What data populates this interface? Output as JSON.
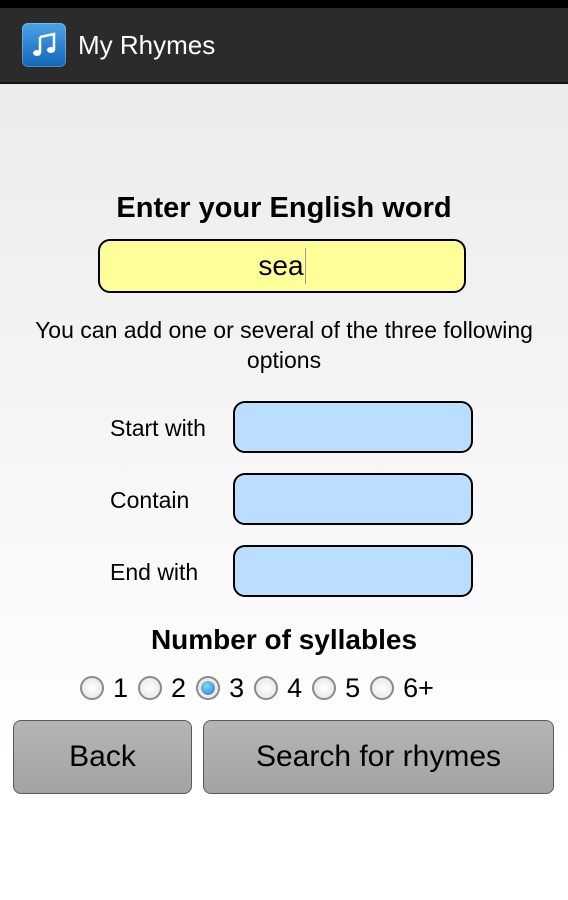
{
  "app": {
    "title": "My Rhymes",
    "icon": "music-note-icon",
    "accent_color": "#1565b8"
  },
  "word": {
    "label": "Enter your English word",
    "value": "sea"
  },
  "hint": "You can add one or several of the three following options",
  "options": [
    {
      "label": "Start with",
      "value": ""
    },
    {
      "label": "Contain",
      "value": ""
    },
    {
      "label": "End with",
      "value": ""
    }
  ],
  "syllables": {
    "label": "Number of syllables",
    "choices": [
      "1",
      "2",
      "3",
      "4",
      "5",
      "6+"
    ],
    "selected": "3"
  },
  "buttons": {
    "back": "Back",
    "search": "Search for rhymes"
  }
}
